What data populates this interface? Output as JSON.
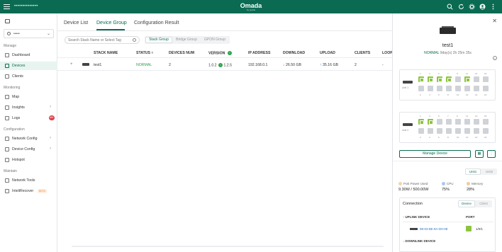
{
  "topbar": {
    "site_name": "••••••••••••••",
    "brand": "Omada",
    "brand_sub": "by tp-link",
    "icons": [
      "search-icon",
      "refresh-icon",
      "settings-icon",
      "account-icon",
      "more-icon"
    ]
  },
  "sidebar": {
    "site_selector": "•••••",
    "sections": {
      "manage": "Manage",
      "monitoring": "Monitoring",
      "configuration": "Configuration",
      "maintain": "Maintain"
    },
    "items": {
      "dashboard": "Dashboard",
      "devices": "Devices",
      "clients": "Clients",
      "map": "Map",
      "insights": "Insights",
      "logs": "Logs",
      "logs_badge": "99+",
      "network_config": "Network Config",
      "device_config": "Device Config",
      "hotspot": "Hotspot",
      "network_tools": "Network Tools",
      "intellirecover": "InteliRecover",
      "beta": "BETA"
    }
  },
  "main": {
    "tabs": [
      "Device List",
      "Device Group",
      "Configuration Result"
    ],
    "search_placeholder": "Search Stack Name or Select Tag",
    "segments": [
      "Stack Group",
      "Bridge Group",
      "GPON Group"
    ],
    "columns": {
      "name": "STACK NAME",
      "status": "STATUS",
      "devices": "DEVICES NUM",
      "version": "VERSION",
      "ip": "IP ADDRESS",
      "download": "DOWNLOAD",
      "upload": "UPLOAD",
      "clients": "CLIENTS",
      "loop": "LOOP"
    },
    "row": {
      "name": "test1",
      "status": "NORMAL",
      "devices": "2",
      "version": "1.0.2",
      "version_new": "1.2.5",
      "ip": "192.168.0.1",
      "download": "26.50 GB",
      "upload": "35.16 GB",
      "clients": "2",
      "loop": "-"
    }
  },
  "panel": {
    "title": "test1",
    "status": "NORMAL",
    "uptime": "9day(s) 2h 25m 35s",
    "unit1_label": "Unit 1",
    "unit2_label": "Unit 2",
    "port_top_numbers": [
      "1",
      "3",
      "5",
      "7",
      "9",
      "11",
      "13",
      "15"
    ],
    "port_bottom_numbers": [
      "2",
      "4",
      "6",
      "8",
      "10",
      "12",
      "14",
      "16"
    ],
    "unit1_ports_up": [
      1,
      3,
      5,
      7,
      11
    ],
    "unit2_ports_up": [
      1,
      3
    ],
    "manage_button": "Manage Device",
    "unit_tabs": [
      "Unit1",
      "Unit2"
    ],
    "poe_label": "PoE Power Used",
    "poe_value": "9.30W / 500.00W",
    "cpu_label": "CPU",
    "cpu_value": "75%",
    "memory_label": "Memory",
    "memory_value": "28%",
    "connection_title": "Connection",
    "connection_tabs": [
      "Device",
      "Client"
    ],
    "uplink_header": "UPLINK DEVICE",
    "port_header": "PORT",
    "uplink_mac": "98-03-8E-9A-D0-08",
    "uplink_port": "1/0/1",
    "downlink_header": "DOWNLINK DEVICE",
    "colors": {
      "accent": "#0a6b52",
      "port_up": "#8bc53f",
      "port_down": "#cfd2d7"
    }
  }
}
